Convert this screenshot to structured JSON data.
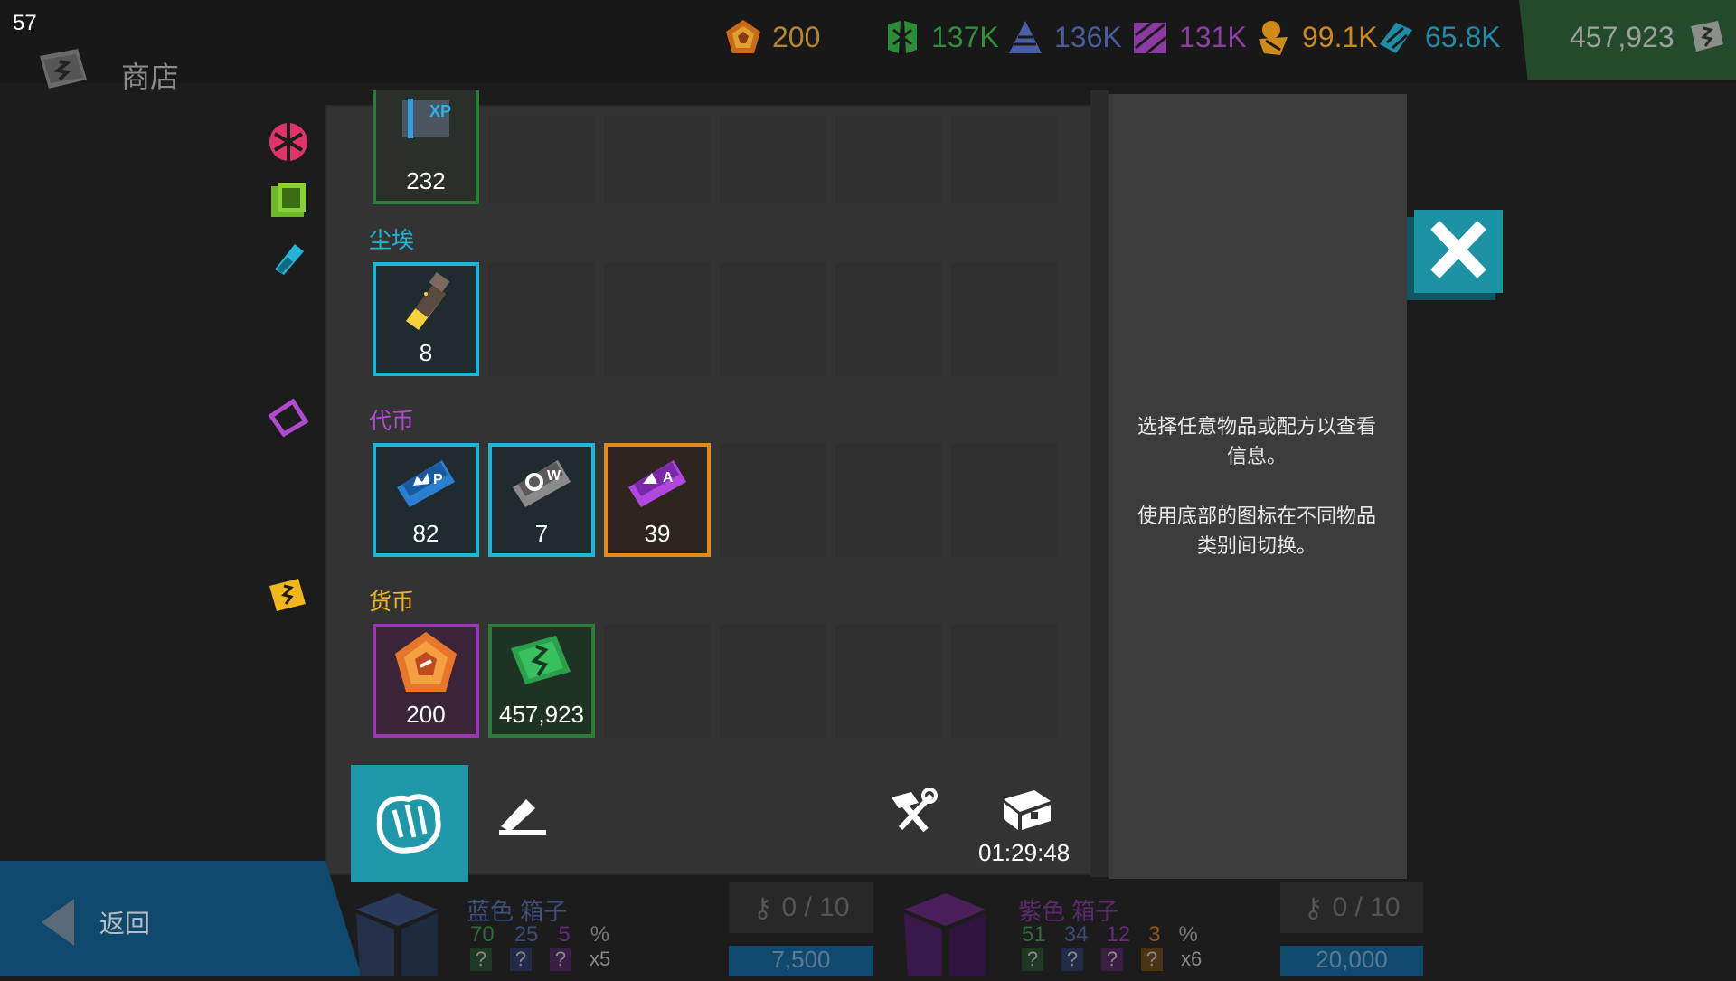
{
  "fps": "57",
  "header": {
    "title": "商店"
  },
  "resources": [
    {
      "name": "pentagon-coin-icon",
      "value": "200",
      "color": "#c07a20"
    },
    {
      "name": "green-shard-icon",
      "value": "137K",
      "color": "#2f9a3e"
    },
    {
      "name": "blue-shard-icon",
      "value": "136K",
      "color": "#4c5fa8"
    },
    {
      "name": "purple-shard-icon",
      "value": "131K",
      "color": "#8b3fa3"
    },
    {
      "name": "orange-shard-icon",
      "value": "99.1K",
      "color": "#d08a1a"
    },
    {
      "name": "cyan-shard-icon",
      "value": "65.8K",
      "color": "#1d8ea6"
    },
    {
      "name": "cash-icon",
      "value": "457,923",
      "color": "#9aa09a"
    }
  ],
  "sections": {
    "xp": {
      "count": "232"
    },
    "dust": {
      "label": "尘埃",
      "items": [
        {
          "icon": "dust-vial-icon",
          "count": "8"
        }
      ]
    },
    "tokens": {
      "label": "代币",
      "items": [
        {
          "icon": "p-token-icon",
          "count": "82"
        },
        {
          "icon": "w-token-icon",
          "count": "7"
        },
        {
          "icon": "a-token-icon",
          "count": "39"
        }
      ]
    },
    "currency": {
      "label": "货币",
      "items": [
        {
          "icon": "pentagon-coin-icon",
          "count": "200"
        },
        {
          "icon": "cash-icon",
          "count": "457,923"
        }
      ]
    }
  },
  "info": {
    "line1": "选择任意物品或配方以查看信息。",
    "line2": "使用底部的图标在不同物品类别间切换。"
  },
  "toolbar": {
    "timer": "01:29:48"
  },
  "footer": {
    "back": "返回",
    "blue_box": {
      "title": "蓝色 箱子",
      "odds": [
        "70",
        "25",
        "5"
      ],
      "percent": "%",
      "mult": "x5",
      "keys": "0 / 10",
      "price": "7,500"
    },
    "purple_box": {
      "title": "紫色 箱子",
      "odds": [
        "51",
        "34",
        "12",
        "3"
      ],
      "percent": "%",
      "mult": "x6",
      "keys": "0 / 10",
      "price": "20,000"
    }
  },
  "colors": {
    "accent": "#1b93a4",
    "dust": "#1fb5d6",
    "tokens": "#b04ad0",
    "currency": "#f0b61a"
  }
}
